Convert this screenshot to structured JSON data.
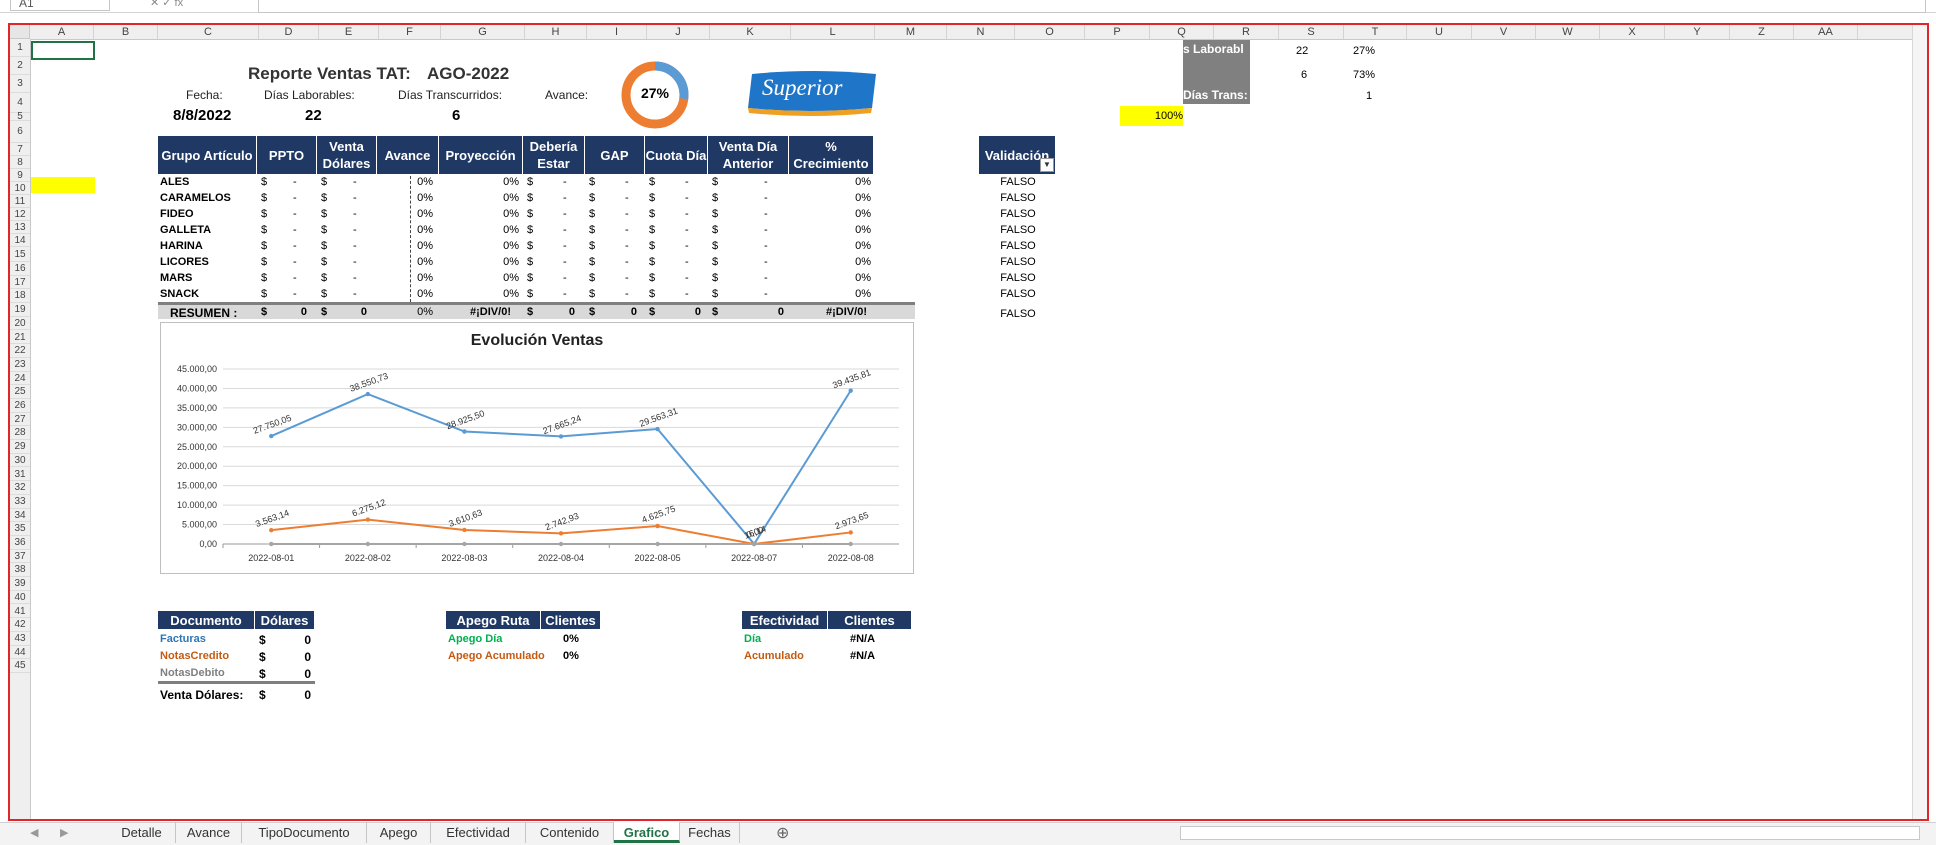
{
  "formula_bar": {
    "name_box": "A1",
    "icons": "✕  ✓  fx",
    "formula": ""
  },
  "columns": [
    "A",
    "B",
    "C",
    "D",
    "E",
    "F",
    "G",
    "H",
    "I",
    "J",
    "K",
    "L",
    "M",
    "N",
    "O",
    "P",
    "Q",
    "R",
    "S",
    "T",
    "U",
    "V",
    "W",
    "X",
    "Y",
    "Z",
    "AA"
  ],
  "rows": [
    "1",
    "2",
    "3",
    "4",
    "5",
    "6",
    "7",
    "8",
    "9",
    "10",
    "11",
    "12",
    "13",
    "14",
    "15",
    "16",
    "17",
    "18",
    "19",
    "20",
    "21",
    "22",
    "23",
    "24",
    "25",
    "26",
    "27",
    "28",
    "29",
    "30",
    "31",
    "32",
    "33",
    "34",
    "35",
    "36",
    "37",
    "38",
    "39",
    "40",
    "41",
    "42",
    "43",
    "44",
    "45"
  ],
  "header": {
    "title": "Reporte Ventas TAT:",
    "period": "AGO-2022",
    "fecha_label": "Fecha:",
    "fecha_value": "8/8/2022",
    "dias_lab_label": "Días Laborables:",
    "dias_lab_value": "22",
    "dias_trans_label": "Días Transcurridos:",
    "dias_trans_value": "6",
    "avance_label": "Avance:",
    "avance_value": "27%",
    "avance_fraction": 0.27,
    "logo_text": "Superior"
  },
  "side_panel": {
    "q1": "s Laborabl",
    "r1": "22",
    "s1": "27%",
    "r2": "6",
    "s2": "73%",
    "q3": "Días Trans:",
    "s3": "1",
    "p4": "100%"
  },
  "main_table": {
    "headers": [
      "Grupo Artículo",
      "PPTO",
      "Venta Dólares",
      "Avance",
      "Proyección",
      "Debería Estar",
      "GAP",
      "Cuota Día",
      "Venta Día Anterior",
      "% Crecimiento"
    ],
    "validation_header": "Validación",
    "rows": [
      {
        "grupo": "ALES",
        "avance": "0%",
        "proy": "0%",
        "crec": "0%",
        "val": "FALSO"
      },
      {
        "grupo": "CARAMELOS",
        "avance": "0%",
        "proy": "0%",
        "crec": "0%",
        "val": "FALSO"
      },
      {
        "grupo": "FIDEO",
        "avance": "0%",
        "proy": "0%",
        "crec": "0%",
        "val": "FALSO"
      },
      {
        "grupo": "GALLETA",
        "avance": "0%",
        "proy": "0%",
        "crec": "0%",
        "val": "FALSO"
      },
      {
        "grupo": "HARINA",
        "avance": "0%",
        "proy": "0%",
        "crec": "0%",
        "val": "FALSO"
      },
      {
        "grupo": "LICORES",
        "avance": "0%",
        "proy": "0%",
        "crec": "0%",
        "val": "FALSO"
      },
      {
        "grupo": "MARS",
        "avance": "0%",
        "proy": "0%",
        "crec": "0%",
        "val": "FALSO"
      },
      {
        "grupo": "SNACK",
        "avance": "0%",
        "proy": "0%",
        "crec": "0%",
        "val": "FALSO"
      }
    ],
    "currency": "$",
    "dash": "-",
    "summary": {
      "label": "RESUMEN :",
      "ppto": "0",
      "venta": "0",
      "avance": "0%",
      "proy": "#¡DIV/0!",
      "deberia": "0",
      "gap": "0",
      "cuota": "0",
      "anterior": "0",
      "crec": "#¡DIV/0!",
      "val": "FALSO"
    }
  },
  "chart_data": {
    "type": "line",
    "title": "Evolución Ventas",
    "categories": [
      "2022-08-01",
      "2022-08-02",
      "2022-08-03",
      "2022-08-04",
      "2022-08-05",
      "2022-08-07",
      "2022-08-08"
    ],
    "ylim": [
      0,
      45000
    ],
    "yticks": [
      "0,00",
      "5.000,00",
      "10.000,00",
      "15.000,00",
      "20.000,00",
      "25.000,00",
      "30.000,00",
      "35.000,00",
      "40.000,00",
      "45.000,00"
    ],
    "grid": true,
    "series": [
      {
        "values": [
          27750.05,
          38550.73,
          28925.5,
          27665.24,
          29563.31,
          0,
          39435.81
        ],
        "labels": [
          "27.750,05",
          "38.550,73",
          "28.925,50",
          "27.665,24",
          "29.563,31",
          "0,00",
          "39.435,81"
        ],
        "color": "#5b9bd5"
      },
      {
        "values": [
          3563.14,
          6275.12,
          3610.63,
          2742.93,
          4625.75,
          0,
          2973.65
        ],
        "labels": [
          "3.563,14",
          "6.275,12",
          "3.610,63",
          "2.742,93",
          "4.625,75",
          "16,14",
          "2.973,65"
        ],
        "color": "#ed7d31"
      },
      {
        "values": [
          0,
          0,
          0,
          0,
          0,
          0,
          0
        ],
        "labels": [],
        "color": "#a5a5a5"
      }
    ]
  },
  "doc_table": {
    "headers": [
      "Documento",
      "Dólares"
    ],
    "rows": [
      {
        "label": "Facturas",
        "value": "0",
        "color": "#2e75b6"
      },
      {
        "label": "NotasCredito",
        "value": "0",
        "color": "#c55a11"
      },
      {
        "label": "NotasDebito",
        "value": "0",
        "color": "#7f7f7f"
      }
    ],
    "total_label": "Venta Dólares:",
    "total_value": "0"
  },
  "apego_table": {
    "headers": [
      "Apego Ruta",
      "Clientes"
    ],
    "rows": [
      {
        "label": "Apego Día",
        "value": "0%",
        "color": "#00b050"
      },
      {
        "label": "Apego Acumulado",
        "value": "0%",
        "color": "#c55a11"
      }
    ]
  },
  "efect_table": {
    "headers": [
      "Efectividad",
      "Clientes"
    ],
    "rows": [
      {
        "label": "Día",
        "value": "#N/A",
        "color": "#00b050"
      },
      {
        "label": "Acumulado",
        "value": "#N/A",
        "color": "#c55a11"
      }
    ]
  },
  "sheet_tabs": [
    "Detalle",
    "Avance",
    "TipoDocumento",
    "Apego",
    "Efectividad",
    "Contenido",
    "Grafico",
    "Fechas"
  ],
  "active_tab": "Grafico",
  "add_sheet": "⊕"
}
